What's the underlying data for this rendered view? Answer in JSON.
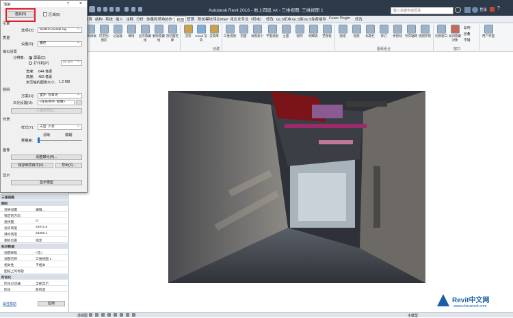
{
  "app": {
    "title": "Autodesk Revit 2016 -    地上四层.rvt - 三维视图: 三维视图 1",
    "search_placeholder": "键入关键字或短语",
    "login": "登录"
  },
  "tabs": [
    "建筑",
    "结构",
    "系统",
    "插入",
    "注释",
    "分析",
    "体量和场地",
    "协作",
    "视图",
    "管理",
    "附加模块",
    "鸿业MEP",
    "鸿业全专业（机电）",
    "修改",
    "GLS机电",
    "GLS族",
    "GLS免费插件",
    "Fuzor Plugin",
    "修改"
  ],
  "ribbon_groups": {
    "create": "创建",
    "sheet_compose": "图纸组合",
    "windows": "窗口"
  },
  "ribbon_buttons": [
    "视图样板",
    "可见性/图形",
    "过滤器",
    "细线",
    "显示隐藏线",
    "删除隐藏线",
    "剖切面轮廓",
    "渲染",
    "Cloud 渲染",
    "渲染库",
    "三维视图",
    "剖面",
    "详图索引",
    "平面视图",
    "立面",
    "图例",
    "明细表",
    "范围框",
    "图纸",
    "视图",
    "标题栏",
    "修订",
    "拼接线",
    "导向轴网",
    "视图参照",
    "切换窗口",
    "关闭隐藏对象",
    "复制",
    "层叠",
    "平铺",
    "用户界面"
  ],
  "dialog": {
    "title": "渲染",
    "help": "?",
    "close": "×",
    "render_button": "渲染(R)",
    "region_label": "区域(E)",
    "engine_label": "引擎",
    "engine_option_label": "选项(O):",
    "engine_option_value": "NVIDIA mental ray",
    "quality_label": "质量",
    "quality_setting_label": "设置(S):",
    "quality_setting_value": "最佳",
    "output_label": "输出设置",
    "resolution_label": "分辨率:",
    "res_screen": "屏幕(C)",
    "res_printer": "打印机(P)",
    "dpi_value": "96 DPI",
    "width_label": "宽度:",
    "width_value": "644 像素",
    "height_label": "高度:",
    "height_value": "483 像素",
    "size_label": "未压缩的图像大小:",
    "size_value": "1.2 MB",
    "lighting_label": "照明",
    "scheme_label": "方案(H):",
    "scheme_value": "室外: 仅日光",
    "sun_label": "日光设置(U):",
    "sun_value": "<在任务中, 照明>",
    "artificial_button": "人造灯光(L)...",
    "background_label": "背景",
    "style_label": "样式(Y):",
    "style_value": "天空: 少云",
    "haze_label": "雾霾度:",
    "clear_label": "清晰",
    "hazy_label": "模糊",
    "image_label": "图像",
    "adjust_button": "调整曝光(A)...",
    "save_button": "保存到项目中(V)...",
    "export_button": "导出(X)...",
    "display_label": "显示",
    "show_model_button": "显示模型"
  },
  "properties": {
    "rows": [
      {
        "k": "三维视图",
        "v": "",
        "hdr": true
      },
      {
        "k": "图形",
        "v": "",
        "hdr": true
      },
      {
        "k": "渲染设置",
        "v": "编辑..."
      },
      {
        "k": "锁定的方向",
        "v": ""
      },
      {
        "k": "透视图",
        "v": "☑"
      },
      {
        "k": "视点高度",
        "v": "23972.8"
      },
      {
        "k": "目标高度",
        "v": "23300.1"
      },
      {
        "k": "相机位置",
        "v": "指定"
      },
      {
        "k": "标识数据",
        "v": "",
        "hdr": true
      },
      {
        "k": "视图样板",
        "v": "<无>"
      },
      {
        "k": "视图名称",
        "v": "三维视图 1"
      },
      {
        "k": "相关性",
        "v": "不相关"
      },
      {
        "k": "图纸上的标题",
        "v": ""
      },
      {
        "k": "阶段化",
        "v": "",
        "hdr": true
      },
      {
        "k": "阶段过滤器",
        "v": "全部显示"
      },
      {
        "k": "阶段",
        "v": "新构造"
      }
    ],
    "help_link": "属性帮助",
    "apply_button": "应用"
  },
  "status": {
    "viewport_label": "透视图",
    "right": "主模型"
  },
  "watermark": {
    "brand": "Revit中文网",
    "url": "www.chinarevit.com"
  },
  "colors": {
    "titlebar": "#2d3a4a",
    "highlight": "#e0202f",
    "revit_blue": "#1b5fa8"
  }
}
